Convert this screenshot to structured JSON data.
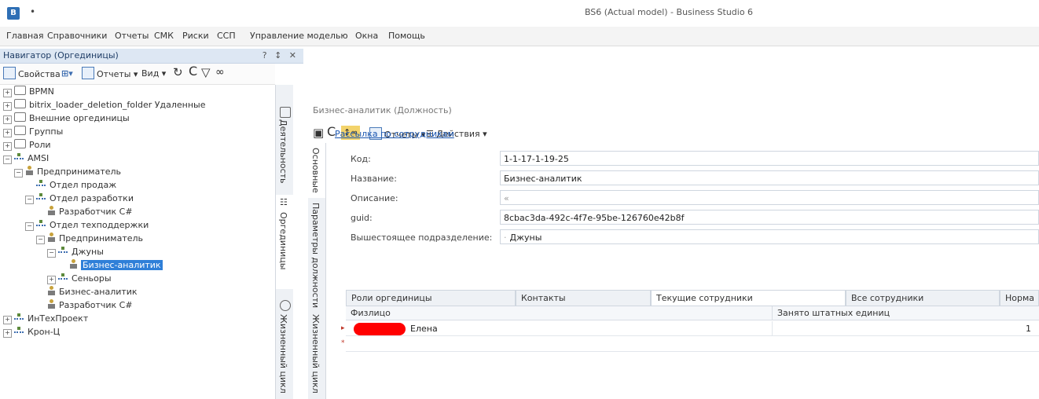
{
  "window": {
    "title": "BS6 (Actual model) - Business Studio 6",
    "qa_dot": "•"
  },
  "menu": {
    "items": [
      "Главная",
      "Справочники",
      "Отчеты",
      "СМК",
      "Риски",
      "ССП",
      "Управление моделью",
      "Окна",
      "Помощь"
    ]
  },
  "navigator": {
    "title": "Навигатор (Оргединицы)",
    "controls": "? ↕ ✕",
    "toolbar": {
      "properties": "Свойства",
      "reports": "Отчеты",
      "view": "Вид"
    },
    "tree": [
      {
        "label": "BPMN",
        "icon": "folder",
        "level": 0,
        "exp": "+"
      },
      {
        "label": "bitrix_loader_deletion_folder Удаленные",
        "icon": "folder",
        "level": 0,
        "exp": "+"
      },
      {
        "label": "Внешние оргединицы",
        "icon": "folder",
        "level": 0,
        "exp": "+"
      },
      {
        "label": "Группы",
        "icon": "folder",
        "level": 0,
        "exp": "+"
      },
      {
        "label": "Роли",
        "icon": "folder",
        "level": 0,
        "exp": "+"
      },
      {
        "label": "AMSI",
        "icon": "org",
        "level": 0,
        "exp": "−"
      },
      {
        "label": "Предприниматель",
        "icon": "person",
        "level": 1,
        "exp": "−"
      },
      {
        "label": "Отдел продаж",
        "icon": "org",
        "level": 2,
        "exp": ""
      },
      {
        "label": "Отдел разработки",
        "icon": "org",
        "level": 2,
        "exp": "−"
      },
      {
        "label": "Разработчик C#",
        "icon": "person",
        "level": 3,
        "exp": ""
      },
      {
        "label": "Отдел техподдержки",
        "icon": "org",
        "level": 2,
        "exp": "−"
      },
      {
        "label": "Предприниматель",
        "icon": "person",
        "level": 3,
        "exp": "−"
      },
      {
        "label": "Джуны",
        "icon": "org",
        "level": 4,
        "exp": "−"
      },
      {
        "label": "Бизнес-аналитик",
        "icon": "person",
        "level": 5,
        "exp": "",
        "selected": true
      },
      {
        "label": "Сеньоры",
        "icon": "org",
        "level": 4,
        "exp": "+"
      },
      {
        "label": "Бизнес-аналитик",
        "icon": "person",
        "level": 3,
        "exp": ""
      },
      {
        "label": "Разработчик C#",
        "icon": "person",
        "level": 3,
        "exp": ""
      },
      {
        "label": "ИнТехПроект",
        "icon": "org",
        "level": 0,
        "exp": "+"
      },
      {
        "label": "Крон-Ц",
        "icon": "org",
        "level": 0,
        "exp": "+"
      }
    ],
    "side_tabs": [
      "Деятельность",
      "Оргединицы",
      "Жизненный цикл"
    ]
  },
  "card": {
    "title": "Бизнес-аналитик (Должность)",
    "toolbar": {
      "reports": "Отчеты",
      "actions": "Действия"
    },
    "side_tabs": [
      "Основные",
      "Параметры должности",
      "Жизненный цикл"
    ],
    "link": "Рассылка по сотрудникам",
    "fields": [
      {
        "label": "Код:",
        "value": "1-1-17-1-19-25"
      },
      {
        "label": "Название:",
        "value": "Бизнес-аналитик"
      },
      {
        "label": "Описание:",
        "value": "«"
      },
      {
        "label": "guid:",
        "value": "8cbac3da-492c-4f7e-95be-126760e42b8f"
      },
      {
        "label": "Вышестоящее подразделение:",
        "value": "Джуны"
      }
    ],
    "grid_tabs": [
      "Роли оргединицы",
      "Контакты",
      "Текущие сотрудники",
      "Все сотрудники",
      "Норма"
    ],
    "grid": {
      "columns": [
        "Физлицо",
        "Занято штатных единиц"
      ],
      "rows": [
        {
          "person": "Елена",
          "units": "1"
        }
      ]
    }
  }
}
